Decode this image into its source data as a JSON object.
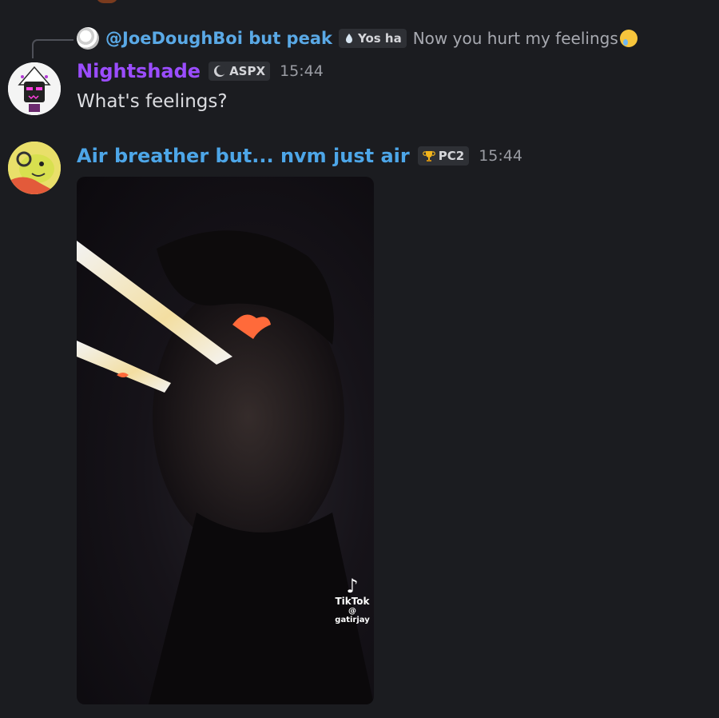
{
  "reply": {
    "username": "@JoeDoughBoi but peak",
    "tag": "Yos ha",
    "text": "Now you hurt my feelings"
  },
  "messages": [
    {
      "username": "Nightshade",
      "name_color": "#9b4dff",
      "tag": "ASPX",
      "time": "15:44",
      "text": "What's feelings?"
    },
    {
      "username": "Air breather but... nvm just air",
      "name_color": "#4da6e8",
      "tag": "PC2",
      "time": "15:44"
    }
  ],
  "video": {
    "watermark_brand": "TikTok",
    "watermark_user": "@ gatirjay"
  }
}
